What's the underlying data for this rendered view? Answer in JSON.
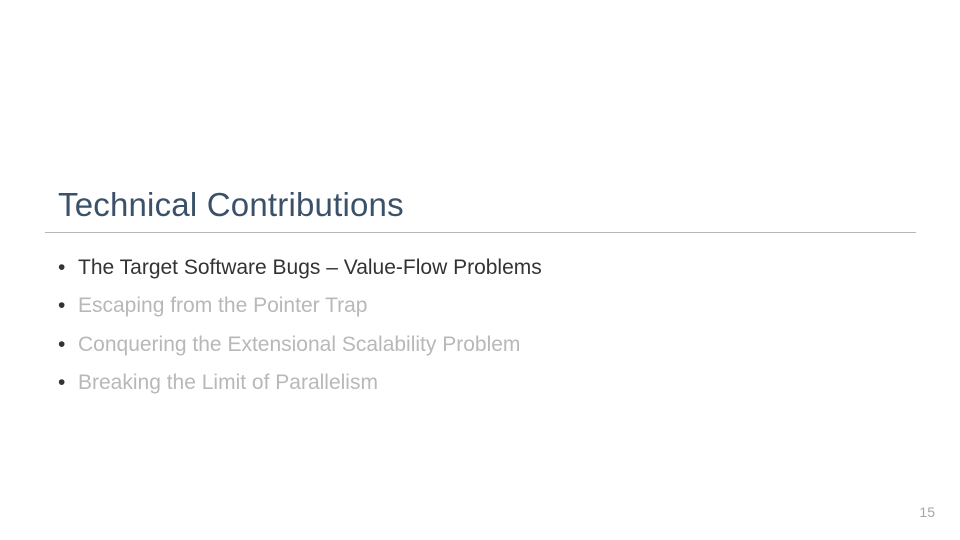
{
  "title": "Technical Contributions",
  "items": [
    {
      "text": "The Target Software Bugs – Value-Flow Problems",
      "active": true
    },
    {
      "text": "Escaping from the Pointer Trap",
      "active": false
    },
    {
      "text": "Conquering the Extensional Scalability Problem",
      "active": false
    },
    {
      "text": "Breaking the Limit of Parallelism",
      "active": false
    }
  ],
  "page_number": "15"
}
